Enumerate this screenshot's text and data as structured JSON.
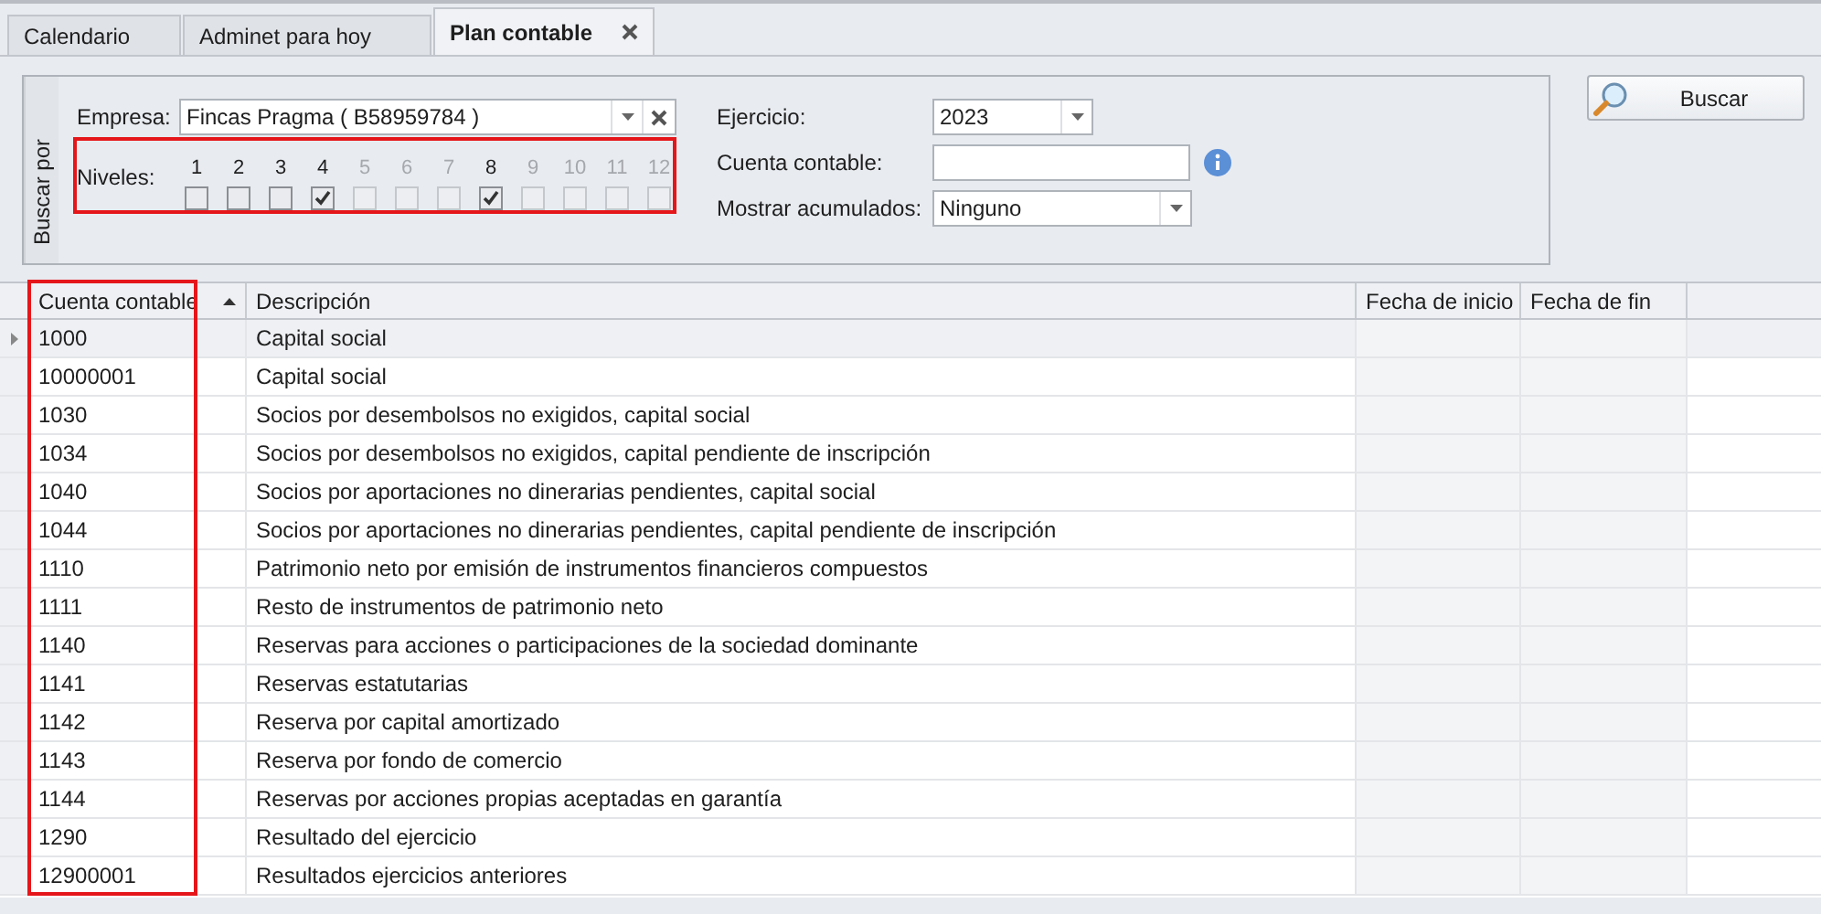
{
  "tabs": [
    {
      "label": "Calendario",
      "selected": false,
      "closable": false
    },
    {
      "label": "Adminet para hoy",
      "selected": false,
      "closable": false
    },
    {
      "label": "Plan contable",
      "selected": true,
      "closable": true
    }
  ],
  "filter": {
    "group_label": "Buscar por",
    "empresa": {
      "label": "Empresa:",
      "value": "Fincas Pragma ( B58959784 )"
    },
    "niveles": {
      "label": "Niveles:",
      "levels": [
        {
          "number": "1",
          "enabled": true,
          "checked": false
        },
        {
          "number": "2",
          "enabled": true,
          "checked": false
        },
        {
          "number": "3",
          "enabled": true,
          "checked": false
        },
        {
          "number": "4",
          "enabled": true,
          "checked": true
        },
        {
          "number": "5",
          "enabled": false,
          "checked": false
        },
        {
          "number": "6",
          "enabled": false,
          "checked": false
        },
        {
          "number": "7",
          "enabled": false,
          "checked": false
        },
        {
          "number": "8",
          "enabled": true,
          "checked": true
        },
        {
          "number": "9",
          "enabled": false,
          "checked": false
        },
        {
          "number": "10",
          "enabled": false,
          "checked": false
        },
        {
          "number": "11",
          "enabled": false,
          "checked": false
        },
        {
          "number": "12",
          "enabled": false,
          "checked": false
        }
      ]
    },
    "ejercicio": {
      "label": "Ejercicio:",
      "value": "2023"
    },
    "cuenta": {
      "label": "Cuenta contable:"
    },
    "acumulados": {
      "label": "Mostrar acumulados:",
      "value": "Ninguno"
    },
    "search_button": "Buscar"
  },
  "table": {
    "columns": [
      {
        "label": "Cuenta contable",
        "sorted": true
      },
      {
        "label": "Descripción",
        "sorted": false
      },
      {
        "label": "Fecha de inicio",
        "sorted": false
      },
      {
        "label": "Fecha de fin",
        "sorted": false
      }
    ],
    "rows": [
      {
        "cuenta": "1000",
        "descripcion": "Capital social",
        "selected": true
      },
      {
        "cuenta": "10000001",
        "descripcion": "Capital social",
        "selected": false
      },
      {
        "cuenta": "1030",
        "descripcion": "Socios por desembolsos no exigidos, capital social",
        "selected": false
      },
      {
        "cuenta": "1034",
        "descripcion": "Socios por desembolsos no exigidos, capital pendiente de inscripción",
        "selected": false
      },
      {
        "cuenta": "1040",
        "descripcion": "Socios por aportaciones no dinerarias pendientes, capital social",
        "selected": false
      },
      {
        "cuenta": "1044",
        "descripcion": "Socios por aportaciones no dinerarias pendientes, capital pendiente de inscripción",
        "selected": false
      },
      {
        "cuenta": "1110",
        "descripcion": "Patrimonio neto por emisión de instrumentos financieros compuestos",
        "selected": false
      },
      {
        "cuenta": "1111",
        "descripcion": "Resto de instrumentos de patrimonio neto",
        "selected": false
      },
      {
        "cuenta": "1140",
        "descripcion": "Reservas para acciones o participaciones de la sociedad dominante",
        "selected": false
      },
      {
        "cuenta": "1141",
        "descripcion": "Reservas estatutarias",
        "selected": false
      },
      {
        "cuenta": "1142",
        "descripcion": "Reserva por capital amortizado",
        "selected": false
      },
      {
        "cuenta": "1143",
        "descripcion": "Reserva por fondo de comercio",
        "selected": false
      },
      {
        "cuenta": "1144",
        "descripcion": "Reservas por acciones propias aceptadas en garantía",
        "selected": false
      },
      {
        "cuenta": "1290",
        "descripcion": "Resultado del ejercicio",
        "selected": false
      },
      {
        "cuenta": "12900001",
        "descripcion": "Resultados ejercicios anteriores",
        "selected": false
      }
    ]
  }
}
